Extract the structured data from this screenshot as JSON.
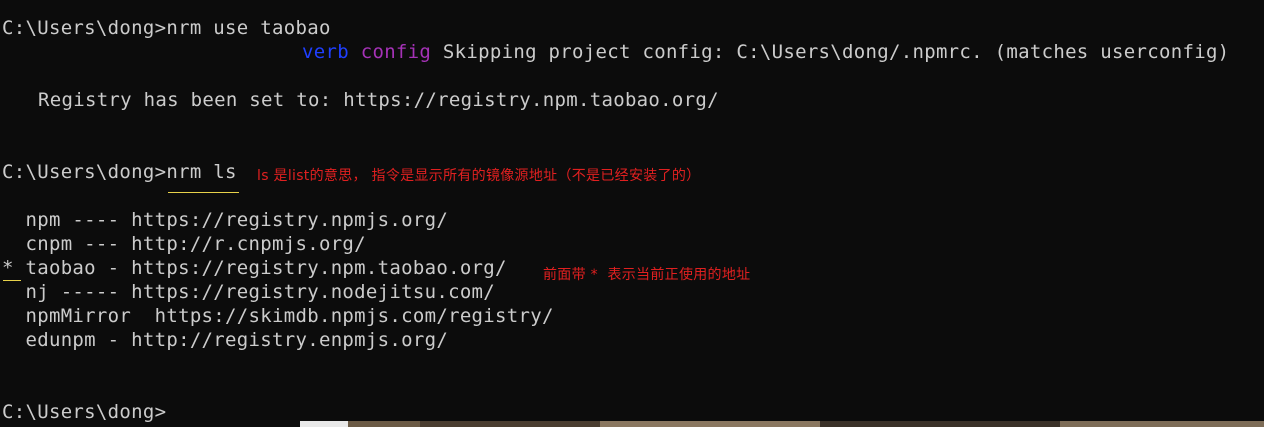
{
  "lines": {
    "cmd1": "C:\\Users\\dong>nrm use taobao",
    "verb": "verb",
    "config": "config",
    "skip": "Skipping project config: C:\\Users\\dong/.npmrc. (matches userconfig)",
    "registry_set": "Registry has been set to: https://registry.npm.taobao.org/",
    "cmd2": "C:\\Users\\dong>nrm ls",
    "prompt_end": "C:\\Users\\dong>"
  },
  "registries": [
    {
      "text": "  npm ---- https://registry.npmjs.org/"
    },
    {
      "text": "  cnpm --- http://r.cnpmjs.org/"
    },
    {
      "text": "* taobao - https://registry.npm.taobao.org/"
    },
    {
      "text": "  nj ----- https://registry.nodejitsu.com/"
    },
    {
      "text": "  npmMirror  https://skimdb.npmjs.com/registry/"
    },
    {
      "text": "  edunpm - http://registry.enpmjs.org/"
    }
  ],
  "annotations": {
    "ls_note": "ls 是list的意思， 指令是显示所有的镜像源地址（不是已经安装了的）",
    "current_note": "前面带 *  表示当前正使用的地址"
  },
  "colors": {
    "background": "#0c0c0c",
    "text": "#cccccc",
    "verb": "#1f3fff",
    "config": "#a532b7",
    "annotation": "#e02020",
    "underline": "#e8d24a"
  }
}
